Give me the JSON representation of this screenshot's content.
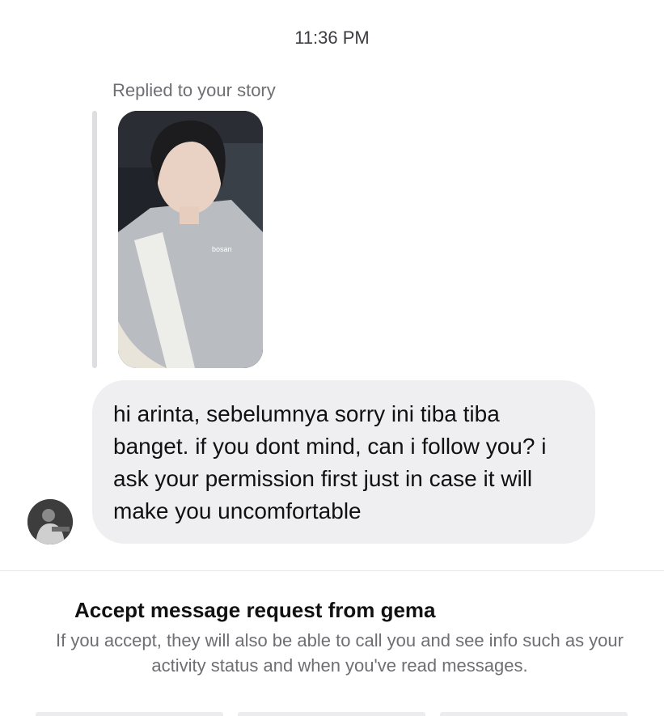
{
  "thread": {
    "timestamp": "11:36 PM",
    "replied_label": "Replied to your story",
    "story_sticker_text": "bosan",
    "message": "hi arinta, sebelumnya sorry ini tiba tiba banget. if you dont mind, can i follow you? i ask your permission first just in case it will make you uncomfortable"
  },
  "request": {
    "title": "Accept message request from gema",
    "description": "If you accept, they will also be able to call you and see info such as your activity status and when you've read messages."
  },
  "colors": {
    "bubble": "#efeff1",
    "secondary_text": "#6e6e73",
    "reply_bar": "#dedee2"
  }
}
